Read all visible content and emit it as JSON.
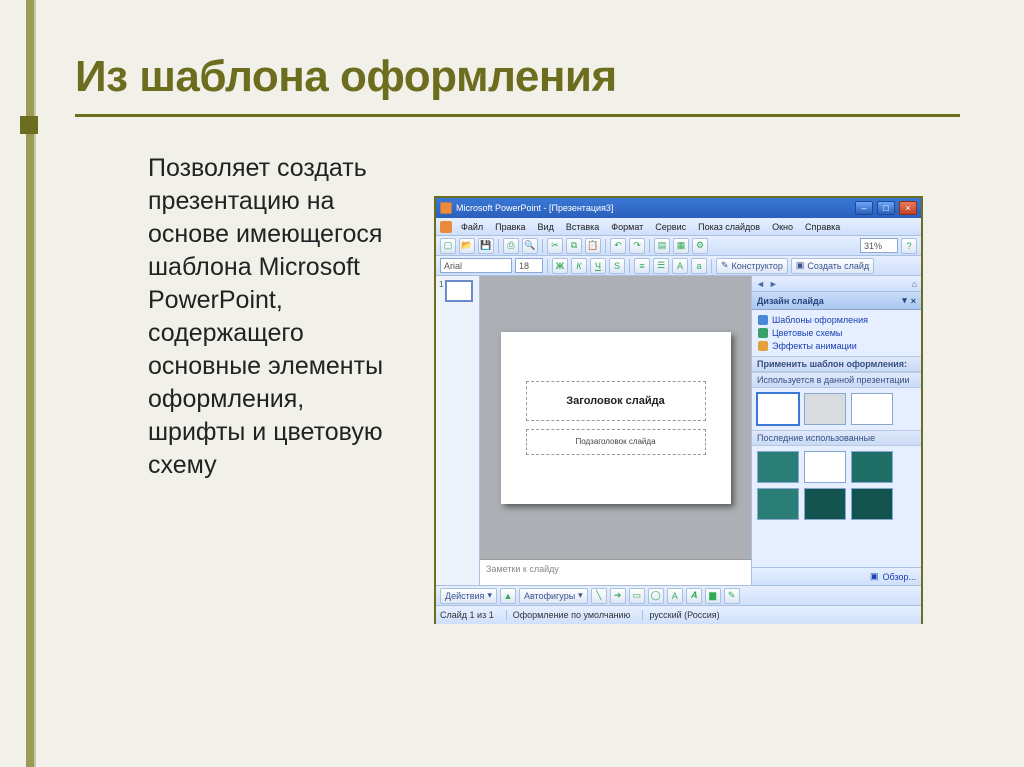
{
  "slide": {
    "title": "Из шаблона оформления",
    "body": "Позволяет создать презентацию на основе имеющегося шаблона Microsoft PowerPoint, содержащего основные элементы оформления, шрифты и цветовую схему"
  },
  "pp": {
    "title": "Microsoft PowerPoint - [Презентация3]",
    "menu": {
      "file": "Файл",
      "edit": "Правка",
      "view": "Вид",
      "insert": "Вставка",
      "format": "Формат",
      "tools": "Сервис",
      "slideshow": "Показ слайдов",
      "window": "Окно",
      "help": "Справка"
    },
    "toolbar": {
      "font": "Arial",
      "size": "18",
      "bold": "Ж",
      "italic": "К",
      "underline": "Ч",
      "shadow": "S",
      "constructor": "Конструктор",
      "newslide": "Создать слайд",
      "zoom": "31%"
    },
    "taskpane": {
      "title": "Дизайн слайда",
      "links": {
        "templates": "Шаблоны оформления",
        "colors": "Цветовые схемы",
        "effects": "Эффекты анимации"
      },
      "apply_label": "Применить шаблон оформления:",
      "used_label": "Используется в данной презентации",
      "recent_label": "Последние использованные",
      "browse": "Обзор..."
    },
    "canvas": {
      "title_placeholder": "Заголовок слайда",
      "subtitle_placeholder": "Подзаголовок слайда"
    },
    "notes_placeholder": "Заметки к слайду",
    "bottombar": {
      "actions": "Действия",
      "autoshapes": "Автофигуры"
    },
    "status": {
      "slide": "Слайд 1 из 1",
      "design": "Оформление по умолчанию",
      "lang": "русский (Россия)"
    },
    "thumb_number": "1"
  }
}
